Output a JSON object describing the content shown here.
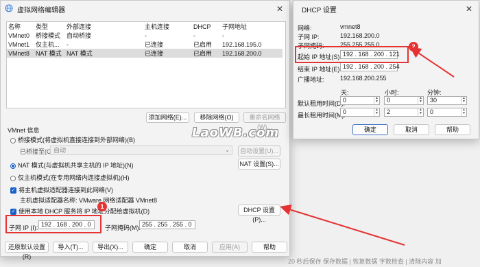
{
  "main_window": {
    "title": "虚拟网络编辑器",
    "table": {
      "headers": [
        "名称",
        "类型",
        "外部连接",
        "主机连接",
        "DHCP",
        "子网地址"
      ],
      "rows": [
        [
          "VMnet0",
          "桥接模式",
          "自动桥接",
          "-",
          "-",
          "-"
        ],
        [
          "VMnet1",
          "仅主机...",
          "-",
          "已连接",
          "已启用",
          "192.168.195.0"
        ],
        [
          "VMnet8",
          "NAT 模式",
          "NAT 模式",
          "已连接",
          "已启用",
          "192.168.200.0"
        ]
      ]
    },
    "add_network": "添加网络(E)...",
    "remove_network": "移除网络(O)",
    "rename_network": "重命名网络(W)...",
    "vmnet_info_label": "VMnet 信息",
    "bridge_mode": "桥接模式(将虚拟机直接连接到外部网络)(B)",
    "bridged_to_label": "已桥接至(G):",
    "bridged_to_value": "自动",
    "auto_settings": "自动设置(U)...",
    "nat_mode": "NAT 模式(与虚拟机共享主机的 IP 地址)(N)",
    "nat_settings": "NAT 设置(S)...",
    "host_only": "仅主机模式(在专用网络内连接虚拟机)(H)",
    "connect_adapter": "将主机虚拟适配器连接到此网络(V)",
    "adapter_name": "主机虚拟适配器名称: VMware 网络适配器 VMnet8",
    "use_dhcp": "使用本地 DHCP 服务将 IP 地址分配给虚拟机(D)",
    "dhcp_settings": "DHCP 设置(P)...",
    "subnet_ip_label": "子网 IP (I):",
    "subnet_ip_value": "192 . 168 . 200 .  0",
    "subnet_mask_label": "子网掩码(M):",
    "subnet_mask_value": "255 . 255 . 255 .  0",
    "restore_defaults": "还原默认设置(R)",
    "import": "导入(T)...",
    "export": "导出(X)...",
    "ok": "确定",
    "cancel": "取消",
    "apply": "应用(A)",
    "help": "帮助"
  },
  "dhcp_window": {
    "title": "DHCP 设置",
    "network_label": "网络:",
    "network_value": "vmnet8",
    "subnet_ip_label": "子网 IP:",
    "subnet_ip_value": "192.168.200.0",
    "subnet_mask_label": "子网掩码:",
    "subnet_mask_value": "255.255.255.0",
    "start_ip_label": "起始 IP 地址(S):",
    "start_ip_value": "192 . 168 . 200 . 121",
    "end_ip_label": "结束 IP 地址(E):",
    "end_ip_value": "192 . 168 . 200 . 254",
    "broadcast_label": "广播地址:",
    "broadcast_value": "192.168.200.255",
    "days_label": "天:",
    "hours_label": "小时:",
    "minutes_label": "分钟:",
    "default_lease_label": "默认租用时间(D):",
    "default_lease": [
      "0",
      "0",
      "30"
    ],
    "max_lease_label": "最长租用时间(M):",
    "max_lease": [
      "0",
      "2",
      "0"
    ],
    "ok": "确定",
    "cancel": "取消",
    "help": "帮助"
  },
  "annotations": {
    "badge1": "1",
    "badge2": "2",
    "color": "#e53232"
  },
  "watermark": "LaoWB.com",
  "statusbar": "20 秒后保存 保存数据 | 恢复数据    字数检查 | 清除内容    加"
}
